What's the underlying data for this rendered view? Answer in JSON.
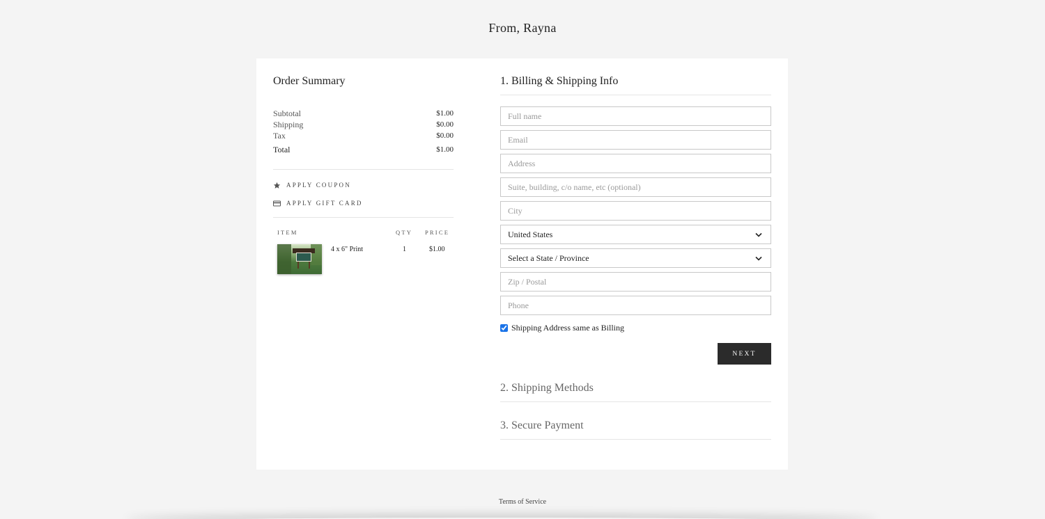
{
  "header": {
    "title": "From, Rayna"
  },
  "summary": {
    "title": "Order Summary",
    "rows": [
      {
        "label": "Subtotal",
        "value": "$1.00"
      },
      {
        "label": "Shipping",
        "value": "$0.00"
      },
      {
        "label": "Tax",
        "value": "$0.00"
      }
    ],
    "total": {
      "label": "Total",
      "value": "$1.00"
    },
    "coupon_label": "APPLY COUPON",
    "gift_card_label": "APPLY GIFT CARD",
    "columns": {
      "item": "ITEM",
      "qty": "QTY",
      "price": "PRICE"
    },
    "items": [
      {
        "name": "4 x 6\" Print",
        "qty": "1",
        "price": "$1.00"
      }
    ]
  },
  "billing": {
    "title": "1. Billing & Shipping Info",
    "fields": {
      "full_name": "Full name",
      "email": "Email",
      "address": "Address",
      "suite": "Suite, building, c/o name, etc (optional)",
      "city": "City",
      "country": "United States",
      "state": "Select a State / Province",
      "zip": "Zip / Postal",
      "phone": "Phone"
    },
    "same_address_label": "Shipping Address same as Billing",
    "same_address_checked": true,
    "next_label": "NEXT"
  },
  "steps": {
    "shipping_methods": "2. Shipping Methods",
    "secure_payment": "3. Secure Payment"
  },
  "footer": {
    "terms": "Terms of Service"
  },
  "colors": {
    "background": "#f4f4f4",
    "button": "#2b2b2b",
    "checkbox": "#1a73e8"
  }
}
